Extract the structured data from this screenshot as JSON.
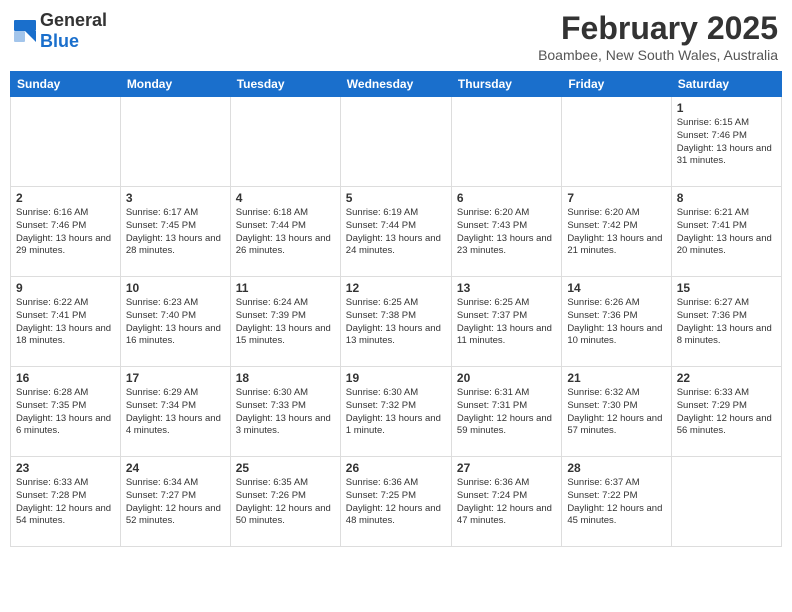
{
  "header": {
    "logo": {
      "general": "General",
      "blue": "Blue"
    },
    "title": "February 2025",
    "location": "Boambee, New South Wales, Australia"
  },
  "days_of_week": [
    "Sunday",
    "Monday",
    "Tuesday",
    "Wednesday",
    "Thursday",
    "Friday",
    "Saturday"
  ],
  "weeks": [
    [
      null,
      null,
      null,
      null,
      null,
      null,
      {
        "day": 1,
        "sunrise": "6:15 AM",
        "sunset": "7:46 PM",
        "daylight": "13 hours and 31 minutes."
      }
    ],
    [
      {
        "day": 2,
        "sunrise": "6:16 AM",
        "sunset": "7:46 PM",
        "daylight": "13 hours and 29 minutes."
      },
      {
        "day": 3,
        "sunrise": "6:17 AM",
        "sunset": "7:45 PM",
        "daylight": "13 hours and 28 minutes."
      },
      {
        "day": 4,
        "sunrise": "6:18 AM",
        "sunset": "7:44 PM",
        "daylight": "13 hours and 26 minutes."
      },
      {
        "day": 5,
        "sunrise": "6:19 AM",
        "sunset": "7:44 PM",
        "daylight": "13 hours and 24 minutes."
      },
      {
        "day": 6,
        "sunrise": "6:20 AM",
        "sunset": "7:43 PM",
        "daylight": "13 hours and 23 minutes."
      },
      {
        "day": 7,
        "sunrise": "6:20 AM",
        "sunset": "7:42 PM",
        "daylight": "13 hours and 21 minutes."
      },
      {
        "day": 8,
        "sunrise": "6:21 AM",
        "sunset": "7:41 PM",
        "daylight": "13 hours and 20 minutes."
      }
    ],
    [
      {
        "day": 9,
        "sunrise": "6:22 AM",
        "sunset": "7:41 PM",
        "daylight": "13 hours and 18 minutes."
      },
      {
        "day": 10,
        "sunrise": "6:23 AM",
        "sunset": "7:40 PM",
        "daylight": "13 hours and 16 minutes."
      },
      {
        "day": 11,
        "sunrise": "6:24 AM",
        "sunset": "7:39 PM",
        "daylight": "13 hours and 15 minutes."
      },
      {
        "day": 12,
        "sunrise": "6:25 AM",
        "sunset": "7:38 PM",
        "daylight": "13 hours and 13 minutes."
      },
      {
        "day": 13,
        "sunrise": "6:25 AM",
        "sunset": "7:37 PM",
        "daylight": "13 hours and 11 minutes."
      },
      {
        "day": 14,
        "sunrise": "6:26 AM",
        "sunset": "7:36 PM",
        "daylight": "13 hours and 10 minutes."
      },
      {
        "day": 15,
        "sunrise": "6:27 AM",
        "sunset": "7:36 PM",
        "daylight": "13 hours and 8 minutes."
      }
    ],
    [
      {
        "day": 16,
        "sunrise": "6:28 AM",
        "sunset": "7:35 PM",
        "daylight": "13 hours and 6 minutes."
      },
      {
        "day": 17,
        "sunrise": "6:29 AM",
        "sunset": "7:34 PM",
        "daylight": "13 hours and 4 minutes."
      },
      {
        "day": 18,
        "sunrise": "6:30 AM",
        "sunset": "7:33 PM",
        "daylight": "13 hours and 3 minutes."
      },
      {
        "day": 19,
        "sunrise": "6:30 AM",
        "sunset": "7:32 PM",
        "daylight": "13 hours and 1 minute."
      },
      {
        "day": 20,
        "sunrise": "6:31 AM",
        "sunset": "7:31 PM",
        "daylight": "12 hours and 59 minutes."
      },
      {
        "day": 21,
        "sunrise": "6:32 AM",
        "sunset": "7:30 PM",
        "daylight": "12 hours and 57 minutes."
      },
      {
        "day": 22,
        "sunrise": "6:33 AM",
        "sunset": "7:29 PM",
        "daylight": "12 hours and 56 minutes."
      }
    ],
    [
      {
        "day": 23,
        "sunrise": "6:33 AM",
        "sunset": "7:28 PM",
        "daylight": "12 hours and 54 minutes."
      },
      {
        "day": 24,
        "sunrise": "6:34 AM",
        "sunset": "7:27 PM",
        "daylight": "12 hours and 52 minutes."
      },
      {
        "day": 25,
        "sunrise": "6:35 AM",
        "sunset": "7:26 PM",
        "daylight": "12 hours and 50 minutes."
      },
      {
        "day": 26,
        "sunrise": "6:36 AM",
        "sunset": "7:25 PM",
        "daylight": "12 hours and 48 minutes."
      },
      {
        "day": 27,
        "sunrise": "6:36 AM",
        "sunset": "7:24 PM",
        "daylight": "12 hours and 47 minutes."
      },
      {
        "day": 28,
        "sunrise": "6:37 AM",
        "sunset": "7:22 PM",
        "daylight": "12 hours and 45 minutes."
      },
      null
    ]
  ]
}
